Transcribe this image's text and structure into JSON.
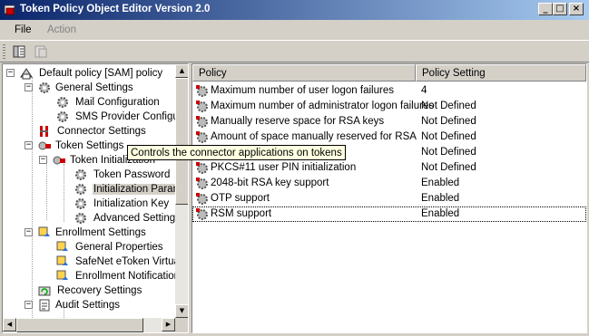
{
  "window": {
    "title": "Token Policy Object Editor Version 2.0",
    "min_glyph": "_",
    "max_glyph": "□",
    "close_glyph": "×"
  },
  "menu": {
    "file": "File",
    "action": "Action"
  },
  "tree": {
    "items": [
      {
        "label": "Default policy [SAM] policy",
        "icon": "policy-icon"
      },
      {
        "label": "General Settings",
        "icon": "gear-icon"
      },
      {
        "label": "Mail Configuration",
        "icon": "gear-icon"
      },
      {
        "label": "SMS Provider Configuration",
        "icon": "gear-icon"
      },
      {
        "label": "Connector Settings",
        "icon": "connector-icon"
      },
      {
        "label": "Token Settings",
        "icon": "token-icon"
      },
      {
        "label": "Token Initialization",
        "icon": "token-icon"
      },
      {
        "label": "Token Password",
        "icon": "gear-icon"
      },
      {
        "label": "Initialization Parameters",
        "icon": "gear-icon"
      },
      {
        "label": "Initialization Key",
        "icon": "gear-icon"
      },
      {
        "label": "Advanced Settings",
        "icon": "gear-icon"
      },
      {
        "label": "Enrollment Settings",
        "icon": "enroll-icon"
      },
      {
        "label": "General Properties",
        "icon": "enroll-icon"
      },
      {
        "label": "SafeNet eToken Virtual",
        "icon": "enroll-icon"
      },
      {
        "label": "Enrollment Notification",
        "icon": "enroll-icon"
      },
      {
        "label": "Recovery Settings",
        "icon": "recovery-icon"
      },
      {
        "label": "Audit Settings",
        "icon": "audit-icon"
      }
    ],
    "expander_minus": "−"
  },
  "list": {
    "columns": [
      "Policy",
      "Policy Setting"
    ],
    "rows": [
      {
        "name": "Maximum number of user logon failures",
        "value": "4",
        "icon": "setting-icon"
      },
      {
        "name": "Maximum number of administrator logon failures",
        "value": "Not Defined",
        "icon": "setting-icon"
      },
      {
        "name": "Manually reserve space for RSA keys",
        "value": "Not Defined",
        "icon": "setting-icon"
      },
      {
        "name": "Amount of space manually reserved for RSA",
        "value": "Not Defined",
        "icon": "setting-icon"
      },
      {
        "name": "",
        "value": "Not Defined",
        "icon": "setting-icon"
      },
      {
        "name": "PKCS#11 user PIN initialization",
        "value": "Not Defined",
        "icon": "setting-icon"
      },
      {
        "name": "2048-bit RSA key support",
        "value": "Enabled",
        "icon": "setting-icon"
      },
      {
        "name": "OTP support",
        "value": "Enabled",
        "icon": "setting-icon"
      },
      {
        "name": "RSM support",
        "value": "Enabled",
        "icon": "setting-icon"
      }
    ]
  },
  "tooltip": {
    "text": "Controls the connector applications on tokens"
  },
  "scroll": {
    "up": "▲",
    "down": "▼",
    "left": "◀",
    "right": "▶"
  },
  "colors": {
    "titlebar_start": "#0a246a",
    "titlebar_end": "#a6caf0",
    "face": "#d4d0c8",
    "tooltip_bg": "#ffffe1"
  }
}
